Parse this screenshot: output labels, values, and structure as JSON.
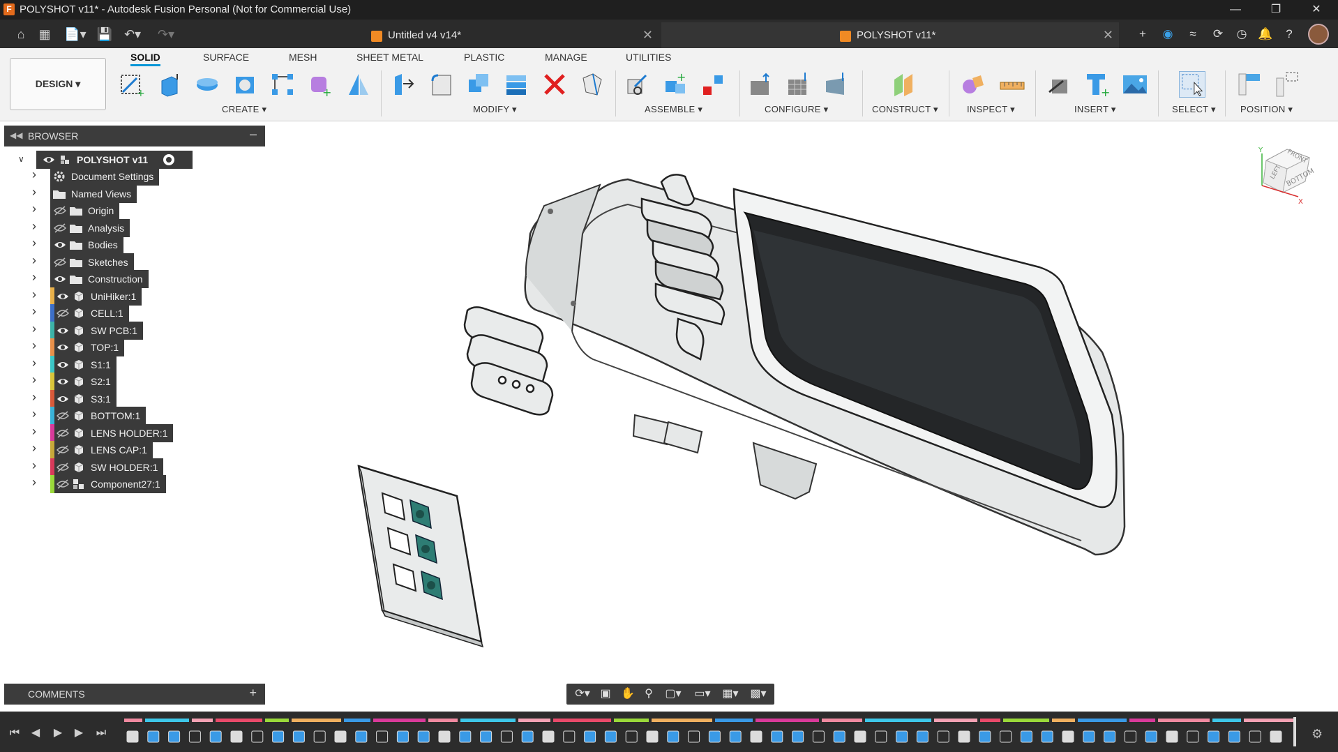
{
  "titlebar": {
    "app_icon": "F",
    "title": "POLYSHOT v11* - Autodesk Fusion Personal (Not for Commercial Use)"
  },
  "tabs": [
    {
      "label": "Untitled v4 v14*"
    },
    {
      "label": "POLYSHOT v11*"
    }
  ],
  "ribbon": {
    "workspace": "DESIGN ▾",
    "tabs": [
      "SOLID",
      "SURFACE",
      "MESH",
      "SHEET METAL",
      "PLASTIC",
      "MANAGE",
      "UTILITIES"
    ],
    "groups": [
      "CREATE ▾",
      "MODIFY ▾",
      "ASSEMBLE ▾",
      "CONFIGURE ▾",
      "CONSTRUCT ▾",
      "INSPECT ▾",
      "INSERT ▾",
      "SELECT ▾",
      "POSITION ▾"
    ]
  },
  "browser": {
    "title": "BROWSER",
    "root": "POLYSHOT v11",
    "items": [
      {
        "label": "Document Settings",
        "icon": "gear-icon",
        "visibility": "none",
        "color": ""
      },
      {
        "label": "Named Views",
        "icon": "folder-icon",
        "visibility": "none",
        "color": ""
      },
      {
        "label": "Origin",
        "icon": "folder-icon",
        "visibility": "hidden",
        "color": ""
      },
      {
        "label": "Analysis",
        "icon": "folder-icon",
        "visibility": "hidden",
        "color": ""
      },
      {
        "label": "Bodies",
        "icon": "folder-icon",
        "visibility": "visible",
        "color": ""
      },
      {
        "label": "Sketches",
        "icon": "folder-icon",
        "visibility": "hidden",
        "color": ""
      },
      {
        "label": "Construction",
        "icon": "folder-icon",
        "visibility": "visible",
        "color": ""
      },
      {
        "label": "UniHiker:1",
        "icon": "component-icon",
        "visibility": "visible",
        "color": "#e8b04a"
      },
      {
        "label": "CELL:1",
        "icon": "component-icon",
        "visibility": "hidden",
        "color": "#3d6fc7"
      },
      {
        "label": "SW PCB:1",
        "icon": "component-icon",
        "visibility": "visible",
        "color": "#3cb3a8"
      },
      {
        "label": "TOP:1",
        "icon": "component-icon",
        "visibility": "visible",
        "color": "#e8904a"
      },
      {
        "label": "S1:1",
        "icon": "component-icon",
        "visibility": "visible",
        "color": "#3cc7c7"
      },
      {
        "label": "S2:1",
        "icon": "component-icon",
        "visibility": "visible",
        "color": "#d8c43a"
      },
      {
        "label": "S3:1",
        "icon": "component-icon",
        "visibility": "visible",
        "color": "#d85a3a"
      },
      {
        "label": "BOTTOM:1",
        "icon": "component-icon",
        "visibility": "hidden",
        "color": "#3ab3d8"
      },
      {
        "label": "LENS HOLDER:1",
        "icon": "component-icon",
        "visibility": "hidden",
        "color": "#d83a9a"
      },
      {
        "label": "LENS CAP:1",
        "icon": "component-icon",
        "visibility": "hidden",
        "color": "#c7a83a"
      },
      {
        "label": "SW HOLDER:1",
        "icon": "component-icon",
        "visibility": "hidden",
        "color": "#d83a5a"
      },
      {
        "label": "Component27:1",
        "icon": "assembly-icon",
        "visibility": "hidden",
        "color": "#9ad83a"
      }
    ]
  },
  "comments": {
    "title": "COMMENTS"
  },
  "viewcube": {
    "faces": [
      "LEFT",
      "FRONT",
      "BOTTOM"
    ],
    "axes": [
      "Y",
      "X"
    ]
  },
  "colors": {
    "accent": "#0696d7",
    "panel": "#3c3c3c",
    "ribbon": "#f2f2f2"
  }
}
